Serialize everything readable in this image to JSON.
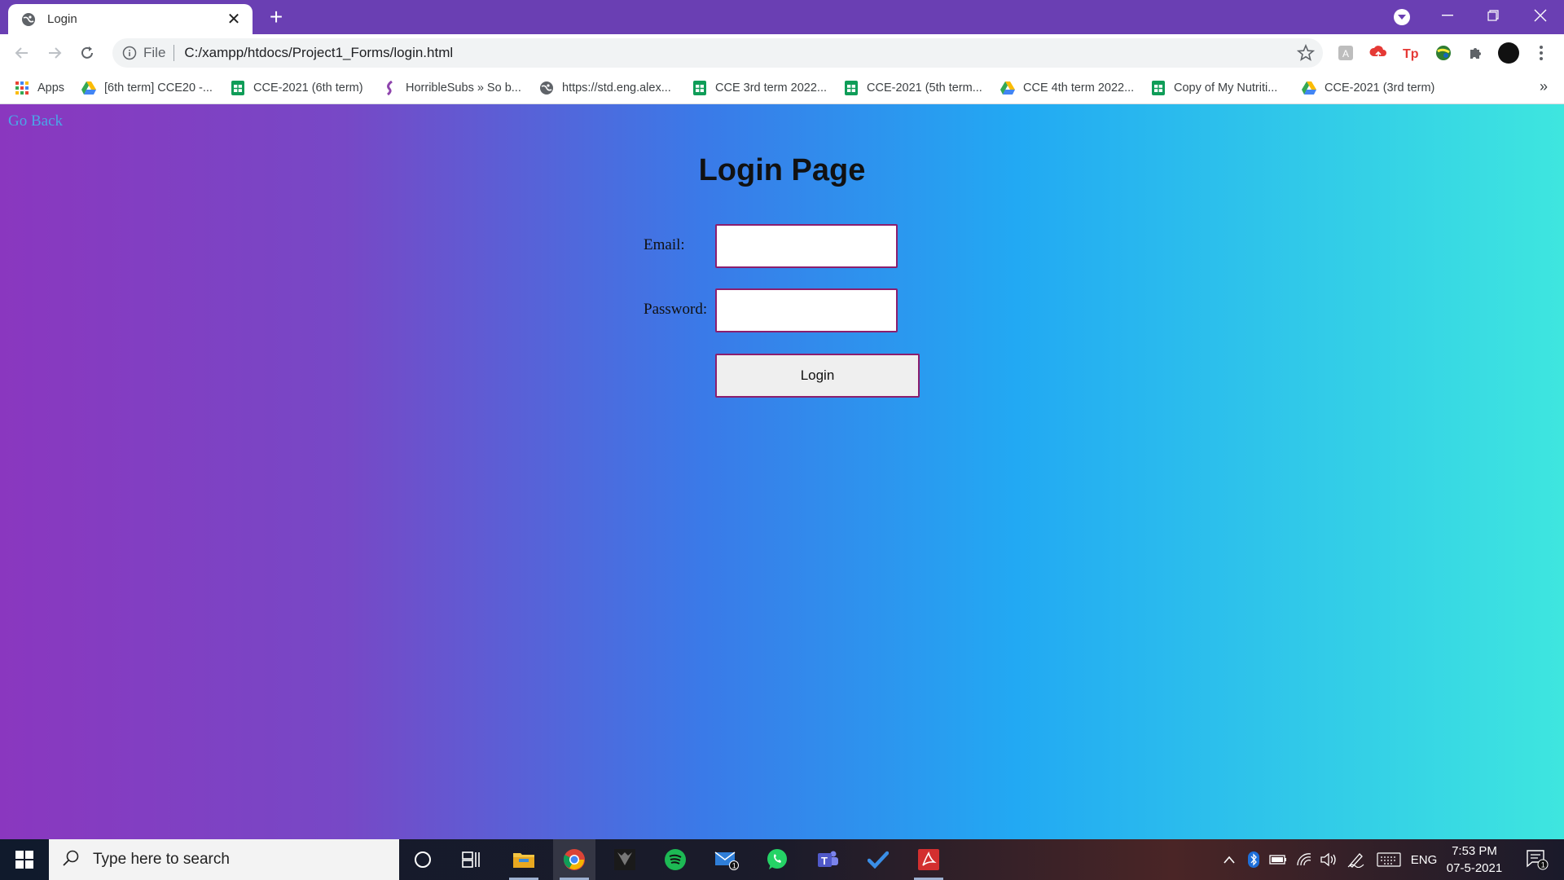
{
  "browser": {
    "tab_title": "Login",
    "address_scheme": "File",
    "address_url": "C:/xampp/htdocs/Project1_Forms/login.html"
  },
  "bookmarks": [
    {
      "label": "Apps",
      "icon": "apps-grid-icon"
    },
    {
      "label": "[6th term] CCE20 -...",
      "icon": "google-drive-icon"
    },
    {
      "label": "CCE-2021 (6th term)",
      "icon": "google-sheets-icon"
    },
    {
      "label": "HorribleSubs » So b...",
      "icon": "horriblesubs-icon"
    },
    {
      "label": "https://std.eng.alex...",
      "icon": "globe-icon"
    },
    {
      "label": "CCE 3rd term 2022...",
      "icon": "google-sheets-icon"
    },
    {
      "label": "CCE-2021 (5th term...",
      "icon": "google-sheets-icon"
    },
    {
      "label": "CCE 4th term 2022...",
      "icon": "google-drive-icon"
    },
    {
      "label": "Copy of My Nutriti...",
      "icon": "google-sheets-icon"
    },
    {
      "label": "CCE-2021 (3rd term)",
      "icon": "google-drive-icon"
    }
  ],
  "page": {
    "go_back": "Go Back",
    "title": "Login Page",
    "email_label": "Email:",
    "password_label": "Password:",
    "email_value": "",
    "password_value": "",
    "login_button": "Login"
  },
  "taskbar": {
    "search_placeholder": "Type here to search",
    "language": "ENG",
    "time": "7:53 PM",
    "date": "07-5-2021",
    "mail_badge": "1",
    "notification_badge": "1"
  },
  "colors": {
    "tabstrip": "#6a3fb3",
    "gradient_start": "#8a37bf",
    "gradient_end": "#3ee6df",
    "input_border": "#8b1e6e",
    "link": "#4aa6e8"
  }
}
